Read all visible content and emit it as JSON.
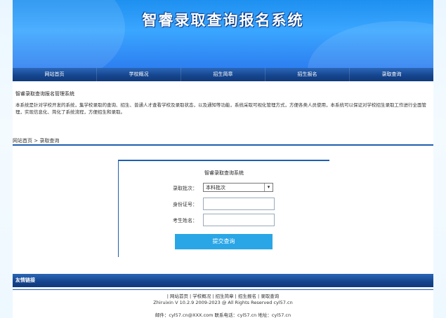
{
  "header": {
    "title": "智睿录取查询报名系统"
  },
  "nav": [
    "网站首页",
    "学校概况",
    "招生简章",
    "招生报名",
    "录取查询"
  ],
  "intro": {
    "title": "智睿录取查询报名管理系统",
    "text": "本系统是针对学校开发的系统，集学校录取的查询、招生、普通人才查看学校及录取状态，以及通知等功能，系统采取可视化管理方式，方便各类人员使用，本系统可以保证对学校招生录取工作进行全面管理，实现信息化、简化了系统流程，方便招生和录取。"
  },
  "breadcrumb": "网站首页 > 录取查询",
  "form": {
    "title": "智睿录取查询系统",
    "type_label": "录取批次：",
    "type_value": "本科批次",
    "id_label": "身份证号：",
    "name_label": "考生姓名：",
    "submit_label": "提交查询"
  },
  "links_bar": {
    "label": "友情链接"
  },
  "footer": {
    "links": "| 网站首页 | 学校概况 | 招生简章 | 招生报名 | 录取查询",
    "copyright": "Zhiruixin V 10.2.9 2009-2023 @ All Rights Reserved cyl57.cn",
    "contact": "邮件：cyl57.cn@XXX.com   联系电话：cyl57.cn    地址：cyl57.cn"
  }
}
